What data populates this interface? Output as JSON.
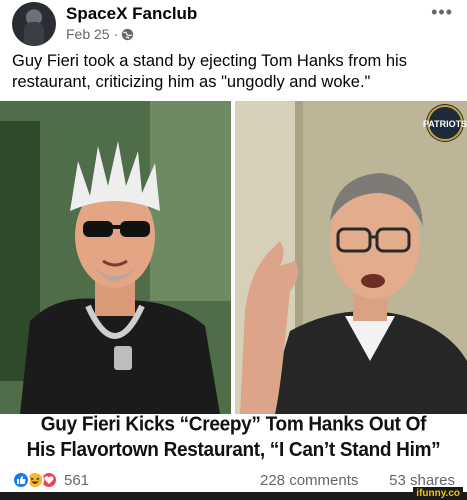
{
  "post": {
    "group_name": "SpaceX Fanclub",
    "date": "Feb 25 ·",
    "caption": "Guy Fieri took a stand by ejecting Tom Hanks from his restaurant, criticizing him as \"ungodly and woke.\""
  },
  "image": {
    "headline_line1": "Guy Fieri Kicks “Creepy” Tom Hanks Out Of",
    "headline_line2": "His Flavortown Restaurant, “I Can’t Stand Him”",
    "logo_text": "PATRIOTS"
  },
  "footer": {
    "reaction_count": "561",
    "comments": "228 comments",
    "shares": "53 shares"
  },
  "watermark": "ifunny.co",
  "colors": {
    "like": "#1877f2",
    "haha": "#f7b928",
    "love": "#f33e58",
    "meta_text": "#65676b"
  }
}
